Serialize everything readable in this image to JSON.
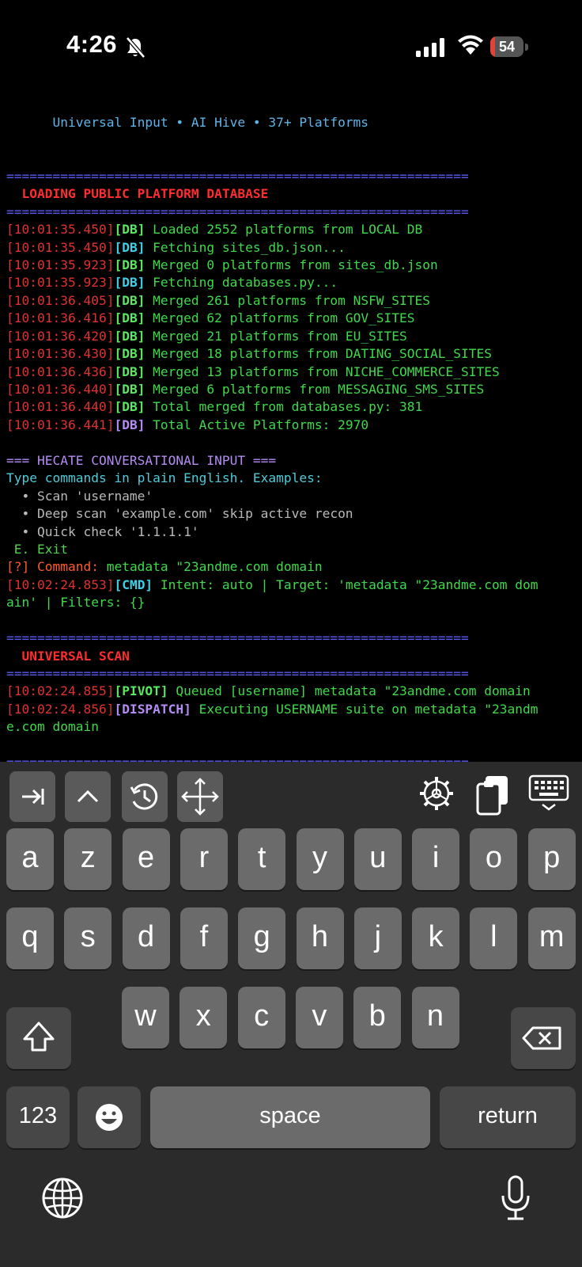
{
  "status_bar": {
    "time": "4:26",
    "battery": "54",
    "battery_level": 0.15
  },
  "terminal": {
    "lines": [
      [
        {
          "t": "",
          "c": "c-white"
        }
      ],
      [
        {
          "t": "      Universal Input • AI Hive • 37+ Platforms",
          "c": "c-blue"
        }
      ],
      [
        {
          "t": "",
          "c": "c-white"
        }
      ],
      [
        {
          "t": "",
          "c": "c-white"
        }
      ],
      [
        {
          "t": "============================================================",
          "c": "c-sep"
        }
      ],
      [
        {
          "t": "  LOADING PUBLIC PLATFORM DATABASE",
          "c": "c-red-bold"
        }
      ],
      [
        {
          "t": "============================================================",
          "c": "c-sep"
        }
      ],
      [
        {
          "t": "[10:01:35.450]",
          "c": "c-ts"
        },
        {
          "t": "[DB]",
          "c": "c-green-tag"
        },
        {
          "t": " Loaded 2552 platforms from LOCAL DB",
          "c": "c-green"
        }
      ],
      [
        {
          "t": "[10:01:35.450]",
          "c": "c-ts"
        },
        {
          "t": "[DB]",
          "c": "c-cyan-tag"
        },
        {
          "t": " Fetching sites_db.json...",
          "c": "c-green"
        }
      ],
      [
        {
          "t": "[10:01:35.923]",
          "c": "c-ts"
        },
        {
          "t": "[DB]",
          "c": "c-green-tag"
        },
        {
          "t": " Merged 0 platforms from sites_db.json",
          "c": "c-green"
        }
      ],
      [
        {
          "t": "[10:01:35.923]",
          "c": "c-ts"
        },
        {
          "t": "[DB]",
          "c": "c-cyan-tag"
        },
        {
          "t": " Fetching databases.py...",
          "c": "c-green"
        }
      ],
      [
        {
          "t": "[10:01:36.405]",
          "c": "c-ts"
        },
        {
          "t": "[DB]",
          "c": "c-green-tag"
        },
        {
          "t": " Merged 261 platforms from NSFW_SITES",
          "c": "c-green"
        }
      ],
      [
        {
          "t": "[10:01:36.416]",
          "c": "c-ts"
        },
        {
          "t": "[DB]",
          "c": "c-green-tag"
        },
        {
          "t": " Merged 62 platforms from GOV_SITES",
          "c": "c-green"
        }
      ],
      [
        {
          "t": "[10:01:36.420]",
          "c": "c-ts"
        },
        {
          "t": "[DB]",
          "c": "c-green-tag"
        },
        {
          "t": " Merged 21 platforms from EU_SITES",
          "c": "c-green"
        }
      ],
      [
        {
          "t": "[10:01:36.430]",
          "c": "c-ts"
        },
        {
          "t": "[DB]",
          "c": "c-green-tag"
        },
        {
          "t": " Merged 18 platforms from DATING_SOCIAL_SITES",
          "c": "c-green"
        }
      ],
      [
        {
          "t": "[10:01:36.436]",
          "c": "c-ts"
        },
        {
          "t": "[DB]",
          "c": "c-green-tag"
        },
        {
          "t": " Merged 13 platforms from NICHE_COMMERCE_SITES",
          "c": "c-green"
        }
      ],
      [
        {
          "t": "[10:01:36.440]",
          "c": "c-ts"
        },
        {
          "t": "[DB]",
          "c": "c-green-tag"
        },
        {
          "t": " Merged 6 platforms from MESSAGING_SMS_SITES",
          "c": "c-green"
        }
      ],
      [
        {
          "t": "[10:01:36.440]",
          "c": "c-ts"
        },
        {
          "t": "[DB]",
          "c": "c-green-tag"
        },
        {
          "t": " Total merged from databases.py: 381",
          "c": "c-green"
        }
      ],
      [
        {
          "t": "[10:01:36.441]",
          "c": "c-ts"
        },
        {
          "t": "[DB]",
          "c": "c-purple-tag"
        },
        {
          "t": " Total Active Platforms: 2970",
          "c": "c-green"
        }
      ],
      [
        {
          "t": "",
          "c": "c-white"
        }
      ],
      [
        {
          "t": "=== HECATE CONVERSATIONAL INPUT ===",
          "c": "c-purple"
        }
      ],
      [
        {
          "t": "Type commands in plain English. Examples:",
          "c": "c-cyan"
        }
      ],
      [
        {
          "t": "  • Scan 'username'",
          "c": "c-gray"
        }
      ],
      [
        {
          "t": "  • Deep scan 'example.com' skip active recon",
          "c": "c-gray"
        }
      ],
      [
        {
          "t": "  • Quick check '1.1.1.1'",
          "c": "c-gray"
        }
      ],
      [
        {
          "t": " E. Exit",
          "c": "c-yellowgreen"
        }
      ],
      [
        {
          "t": "[?] Command: ",
          "c": "c-orange"
        },
        {
          "t": "metadata \"23andme.com domain",
          "c": "c-green"
        }
      ],
      [
        {
          "t": "[10:02:24.853]",
          "c": "c-ts"
        },
        {
          "t": "[CMD]",
          "c": "c-cyan-tag"
        },
        {
          "t": " Intent: auto | Target: 'metadata \"23andme.com dom",
          "c": "c-green"
        }
      ],
      [
        {
          "t": "ain' | Filters: {}",
          "c": "c-green"
        }
      ],
      [
        {
          "t": "",
          "c": "c-white"
        }
      ],
      [
        {
          "t": "============================================================",
          "c": "c-sep"
        }
      ],
      [
        {
          "t": "  UNIVERSAL SCAN",
          "c": "c-red-bold"
        }
      ],
      [
        {
          "t": "============================================================",
          "c": "c-sep"
        }
      ],
      [
        {
          "t": "[10:02:24.855]",
          "c": "c-ts"
        },
        {
          "t": "[PIVOT]",
          "c": "c-green-tag"
        },
        {
          "t": " Queued [username] metadata \"23andme.com domain",
          "c": "c-green"
        }
      ],
      [
        {
          "t": "[10:02:24.856]",
          "c": "c-ts"
        },
        {
          "t": "[DISPATCH]",
          "c": "c-purple-tag"
        },
        {
          "t": " Executing USERNAME suite on metadata \"23andm",
          "c": "c-green"
        }
      ],
      [
        {
          "t": "e.com domain",
          "c": "c-green"
        }
      ],
      [
        {
          "t": "",
          "c": "c-white"
        }
      ],
      [
        {
          "t": "============================================================",
          "c": "c-sep"
        }
      ]
    ]
  },
  "keyboard": {
    "row1": [
      "a",
      "z",
      "e",
      "r",
      "t",
      "y",
      "u",
      "i",
      "o",
      "p"
    ],
    "row2": [
      "q",
      "s",
      "d",
      "f",
      "g",
      "h",
      "j",
      "k",
      "l",
      "m"
    ],
    "row3": [
      "w",
      "x",
      "c",
      "v",
      "b",
      "n"
    ],
    "numbers_label": "123",
    "space_label": "space",
    "return_label": "return"
  }
}
